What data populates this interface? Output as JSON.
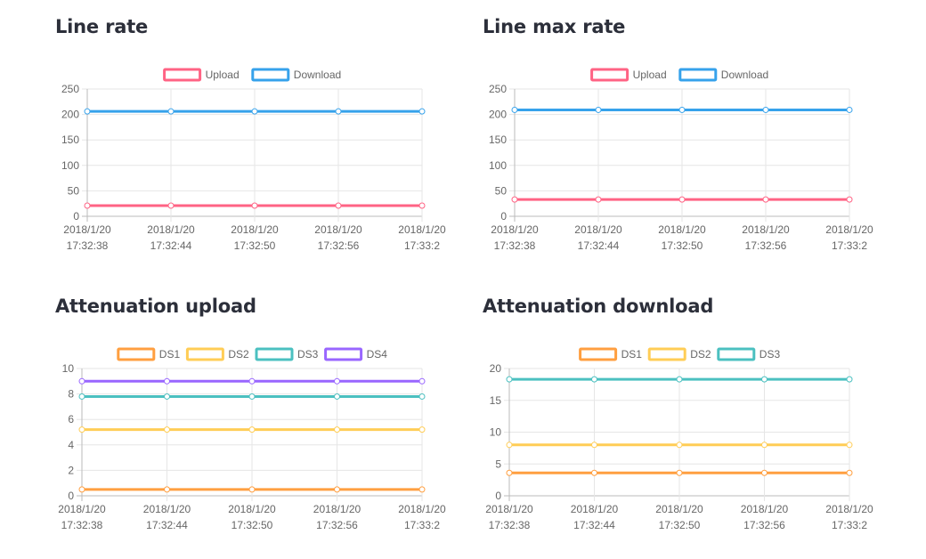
{
  "chart_data": [
    {
      "type": "line",
      "title": "Line rate",
      "x": [
        "2018/1/20 17:32:38",
        "2018/1/20 17:32:44",
        "2018/1/20 17:32:50",
        "2018/1/20 17:32:56",
        "2018/1/20 17:33:2"
      ],
      "ylim": [
        0,
        250
      ],
      "yticks": [
        0,
        50,
        100,
        150,
        200,
        250
      ],
      "legend_position": "top",
      "grid": true,
      "series": [
        {
          "name": "Upload",
          "color": "#ff6384",
          "values": [
            21,
            21,
            21,
            21,
            21
          ]
        },
        {
          "name": "Download",
          "color": "#36a2eb",
          "values": [
            206,
            206,
            206,
            206,
            206
          ]
        }
      ]
    },
    {
      "type": "line",
      "title": "Line max rate",
      "x": [
        "2018/1/20 17:32:38",
        "2018/1/20 17:32:44",
        "2018/1/20 17:32:50",
        "2018/1/20 17:32:56",
        "2018/1/20 17:33:2"
      ],
      "ylim": [
        0,
        250
      ],
      "yticks": [
        0,
        50,
        100,
        150,
        200,
        250
      ],
      "legend_position": "top",
      "grid": true,
      "series": [
        {
          "name": "Upload",
          "color": "#ff6384",
          "values": [
            33,
            33,
            33,
            33,
            33
          ]
        },
        {
          "name": "Download",
          "color": "#36a2eb",
          "values": [
            209,
            209,
            209,
            209,
            209
          ]
        }
      ]
    },
    {
      "type": "line",
      "title": "Attenuation upload",
      "x": [
        "2018/1/20 17:32:38",
        "2018/1/20 17:32:44",
        "2018/1/20 17:32:50",
        "2018/1/20 17:32:56",
        "2018/1/20 17:33:2"
      ],
      "ylim": [
        0,
        10
      ],
      "yticks": [
        0,
        2,
        4,
        6,
        8,
        10
      ],
      "legend_position": "top",
      "grid": true,
      "series": [
        {
          "name": "DS1",
          "color": "#ff9f40",
          "values": [
            0.5,
            0.5,
            0.5,
            0.5,
            0.5
          ]
        },
        {
          "name": "DS2",
          "color": "#ffcd56",
          "values": [
            5.2,
            5.2,
            5.2,
            5.2,
            5.2
          ]
        },
        {
          "name": "DS3",
          "color": "#4bc0c0",
          "values": [
            7.8,
            7.8,
            7.8,
            7.8,
            7.8
          ]
        },
        {
          "name": "DS4",
          "color": "#9966ff",
          "values": [
            9.0,
            9.0,
            9.0,
            9.0,
            9.0
          ]
        }
      ]
    },
    {
      "type": "line",
      "title": "Attenuation download",
      "x": [
        "2018/1/20 17:32:38",
        "2018/1/20 17:32:44",
        "2018/1/20 17:32:50",
        "2018/1/20 17:32:56",
        "2018/1/20 17:33:2"
      ],
      "ylim": [
        0,
        20
      ],
      "yticks": [
        0,
        5,
        10,
        15,
        20
      ],
      "legend_position": "top",
      "grid": true,
      "series": [
        {
          "name": "DS1",
          "color": "#ff9f40",
          "values": [
            3.6,
            3.6,
            3.6,
            3.6,
            3.6
          ]
        },
        {
          "name": "DS2",
          "color": "#ffcd56",
          "values": [
            8.0,
            8.0,
            8.0,
            8.0,
            8.0
          ]
        },
        {
          "name": "DS3",
          "color": "#4bc0c0",
          "values": [
            18.3,
            18.3,
            18.3,
            18.3,
            18.3
          ]
        }
      ]
    }
  ]
}
